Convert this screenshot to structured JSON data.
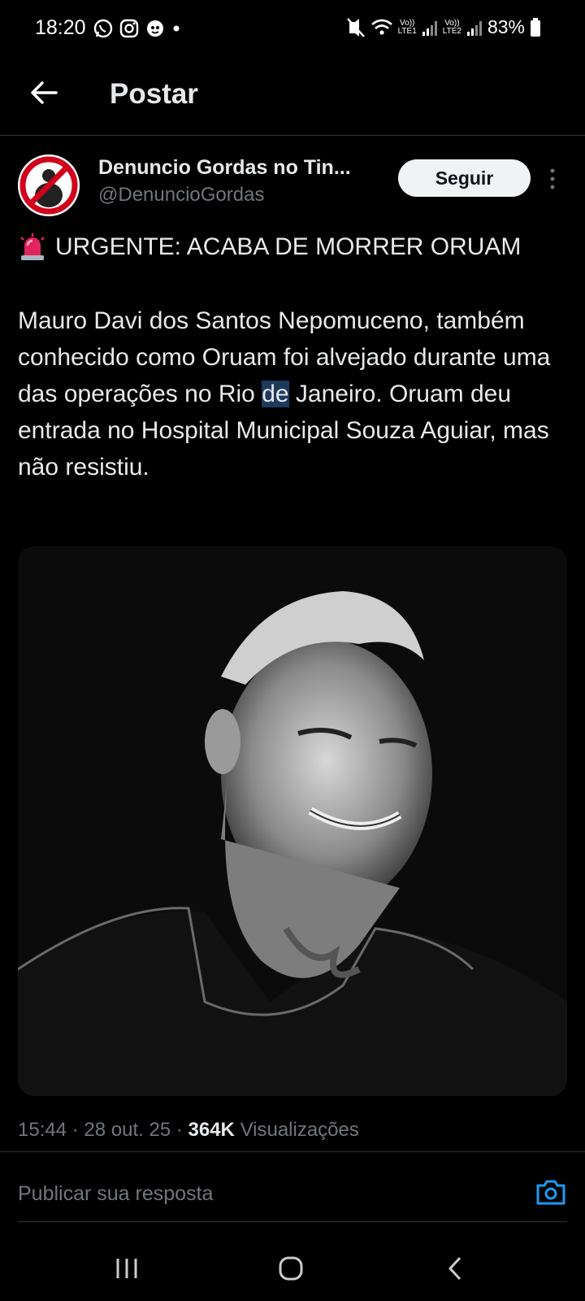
{
  "status_bar": {
    "time": "18:20",
    "left_icons": [
      "whatsapp-icon",
      "instagram-icon",
      "app-notification-icon",
      "dot-icon"
    ],
    "right_icons": [
      "vibrate-mute-icon",
      "wifi-icon",
      "signal-icon",
      "signal-icon",
      "battery-icon"
    ],
    "sim1_label_top": "Vo))",
    "sim1_label_bottom": "LTE1",
    "sim2_label_top": "Vo))",
    "sim2_label_bottom": "LTE2",
    "battery": "83%"
  },
  "header": {
    "back_icon": "arrow-left-icon",
    "title": "Postar"
  },
  "post": {
    "avatar_icon": "no-symbol-avatar-icon",
    "display_name": "Denuncio Gordas no Tin...",
    "handle": "@DenuncioGordas",
    "follow_label": "Seguir",
    "more_icon": "vertical-dots-icon",
    "headline_icon": "siren-icon",
    "headline": "URGENTE: ACABA DE MORRER ORUAM",
    "body_part1": "Mauro Davi dos Santos Nepomuceno, também conhecido como Oruam foi alvejado durante uma das operações no Rio ",
    "body_highlight": "de",
    "body_part2": " Janeiro. Oruam deu entrada no Hospital Municipal Souza Aguiar, mas não resistiu.",
    "image": "black-and-white-portrait-photo",
    "time": "15:44",
    "date": "28 out. 25",
    "views_count": "364K",
    "views_label": "Visualizações"
  },
  "reply": {
    "placeholder": "Publicar sua resposta",
    "camera_icon": "camera-icon"
  },
  "nav": {
    "icons": [
      "recent-apps-icon",
      "home-icon",
      "back-icon"
    ]
  },
  "colors": {
    "background": "#000000",
    "text": "#e7e9ea",
    "secondary_text": "#71767b",
    "accent": "#1d9bf0"
  }
}
